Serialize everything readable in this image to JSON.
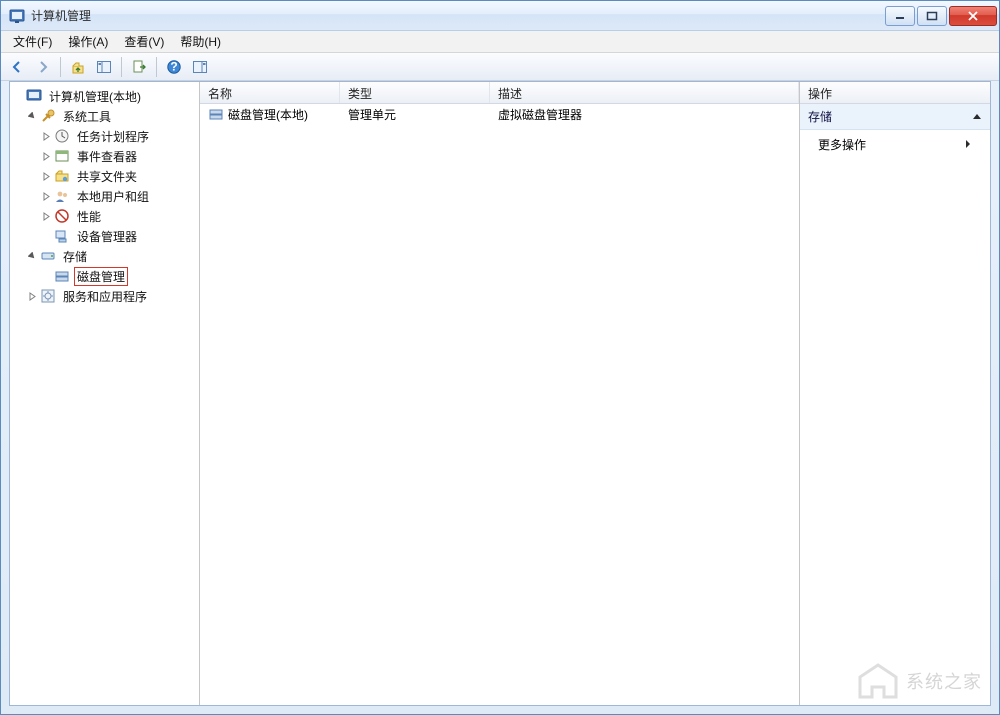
{
  "window": {
    "title": "计算机管理"
  },
  "menu": {
    "file": "文件(F)",
    "action": "操作(A)",
    "view": "查看(V)",
    "help": "帮助(H)"
  },
  "tree": {
    "root": "计算机管理(本地)",
    "system_tools": "系统工具",
    "task_scheduler": "任务计划程序",
    "event_viewer": "事件查看器",
    "shared_folders": "共享文件夹",
    "local_users_groups": "本地用户和组",
    "performance": "性能",
    "device_manager": "设备管理器",
    "storage": "存储",
    "disk_management": "磁盘管理",
    "services_apps": "服务和应用程序"
  },
  "list": {
    "columns": {
      "name": "名称",
      "type": "类型",
      "desc": "描述"
    },
    "rows": [
      {
        "name": "磁盘管理(本地)",
        "type": "管理单元",
        "desc": "虚拟磁盘管理器"
      }
    ]
  },
  "actions": {
    "title": "操作",
    "section": "存储",
    "more": "更多操作"
  },
  "watermark": {
    "text": "系统之家"
  }
}
